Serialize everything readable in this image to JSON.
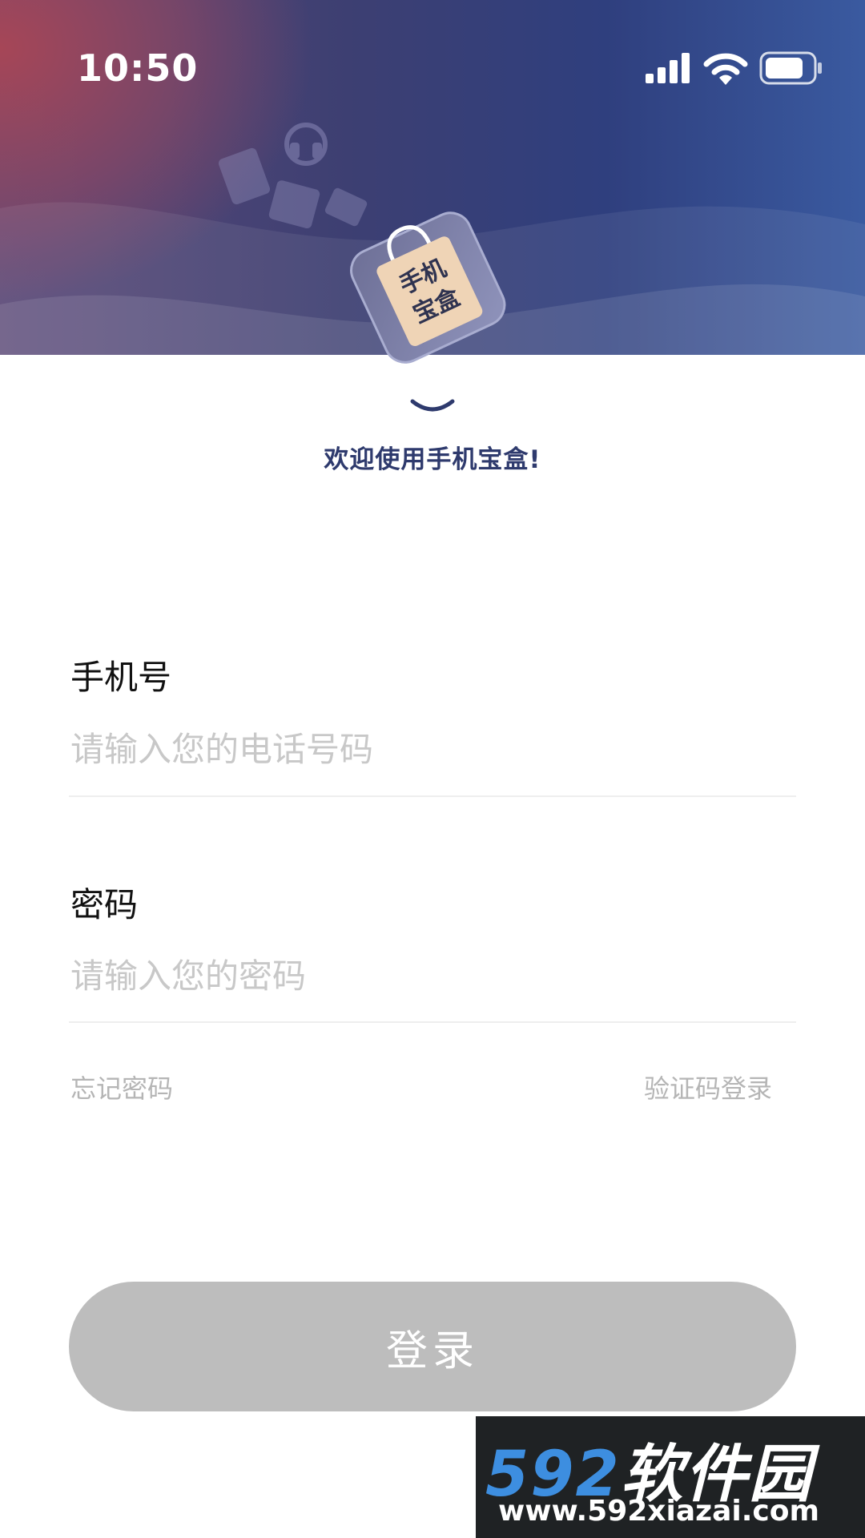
{
  "status_bar": {
    "time": "10:50",
    "icons": [
      "signal-icon",
      "wifi-icon",
      "battery-icon"
    ]
  },
  "header": {
    "logo_text": "手机宝盒",
    "welcome": "欢迎使用手机宝盒!"
  },
  "form": {
    "phone_label": "手机号",
    "phone_placeholder": "请输入您的电话号码",
    "phone_value": "",
    "password_label": "密码",
    "password_placeholder": "请输入您的密码",
    "password_value": "",
    "forgot_password": "忘记密码",
    "sms_login": "验证码登录",
    "login_button": "登录"
  },
  "watermark": {
    "brand_number": "592",
    "brand_text": "软件园",
    "url": "www.592xiazai.com"
  },
  "colors": {
    "hero_left": "#a84a5a",
    "hero_right": "#3a5aa0",
    "welcome_text": "#2e3a6d",
    "button_disabled": "#bdbdbd",
    "watermark_accent": "#3d8ee0"
  }
}
